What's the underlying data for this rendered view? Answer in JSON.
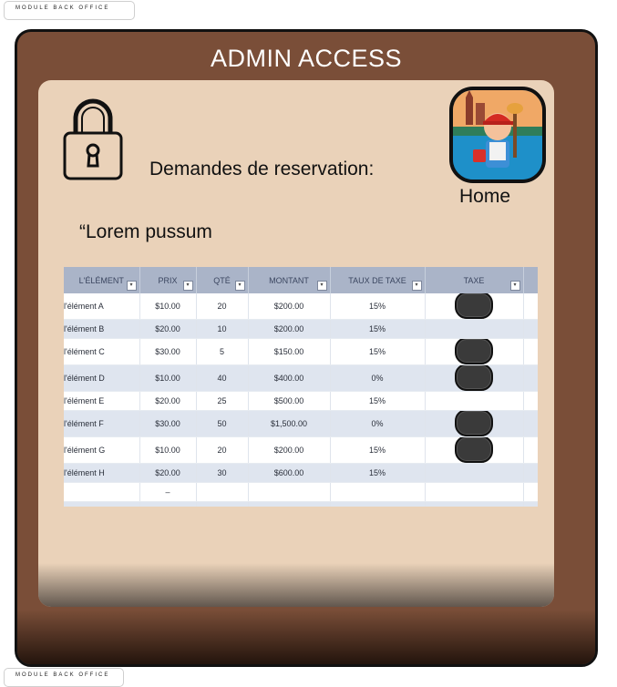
{
  "top_tag": {
    "label": "MODULE BACK OFFICE"
  },
  "bottom_tag": {
    "label": "MODULE BACK OFFICE"
  },
  "panel": {
    "title": "ADMIN ACCESS"
  },
  "content": {
    "heading": "Demandes de reservation:",
    "quote": "“Lorem pussum",
    "home_label": "Home"
  },
  "icons": {
    "lock": "lock-icon",
    "avatar": "cleaner-avatar-icon"
  },
  "colors": {
    "panel": "#7a4e38",
    "inner": "#ead2b9",
    "table_header": "#aab4c8"
  },
  "table": {
    "headers": [
      "L'ÉLÉMENT",
      "PRIX",
      "QTÉ",
      "MONTANT",
      "TAUX DE TAXE",
      "TAXE"
    ],
    "rows": [
      [
        "l'élément A",
        "$10.00",
        "20",
        "$200.00",
        "15%"
      ],
      [
        "l'élément B",
        "$20.00",
        "10",
        "$200.00",
        "15%"
      ],
      [
        "l'élément C",
        "$30.00",
        "5",
        "$150.00",
        "15%"
      ],
      [
        "l'élément D",
        "$10.00",
        "40",
        "$400.00",
        "0%"
      ],
      [
        "l'élément E",
        "$20.00",
        "25",
        "$500.00",
        "15%"
      ],
      [
        "l'élément F",
        "$30.00",
        "50",
        "$1,500.00",
        "0%"
      ],
      [
        "l'élément G",
        "$10.00",
        "20",
        "$200.00",
        "15%"
      ],
      [
        "l'élément H",
        "$20.00",
        "30",
        "$600.00",
        "15%"
      ],
      [
        "",
        "–",
        "",
        "",
        ""
      ],
      [
        "",
        "–",
        "",
        "",
        ""
      ],
      [
        "",
        "–",
        "",
        "",
        ""
      ]
    ]
  }
}
